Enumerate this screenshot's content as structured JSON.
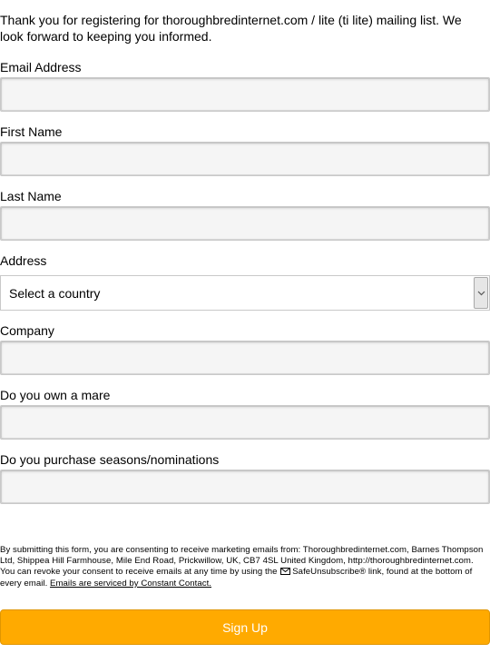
{
  "intro": {
    "text": "Thank you for registering for thoroughbredinternet.com / lite (ti lite) mailing list. We look forward to keeping you informed."
  },
  "form": {
    "email": {
      "label": "Email Address",
      "value": ""
    },
    "first_name": {
      "label": "First Name",
      "value": ""
    },
    "last_name": {
      "label": "Last Name",
      "value": ""
    },
    "address": {
      "label": "Address",
      "country_select": {
        "selected": "Select a country",
        "icon": "chevron-down-icon"
      }
    },
    "company": {
      "label": "Company",
      "value": ""
    },
    "mare": {
      "label": "Do you own a mare",
      "value": ""
    },
    "seasons": {
      "label": "Do you purchase seasons/nominations",
      "value": ""
    }
  },
  "disclaimer": {
    "text_before_icon": "By submitting this form, you are consenting to receive marketing emails from: Thoroughbredinternet.com, Barnes Thompson Ltd, Shippea Hill Farmhouse, Mile End Road, Prickwillow, UK, CB7 4SL United Kingdom, http://thoroughbredinternet.com. You can revoke your consent to receive emails at any time by using the",
    "icon": "envelope-icon",
    "text_after_icon": "SafeUnsubscribe® link, found at the bottom of every email.",
    "link_text": "Emails are serviced by Constant Contact."
  },
  "submit": {
    "label": "Sign Up",
    "color": "#ffaa00"
  }
}
